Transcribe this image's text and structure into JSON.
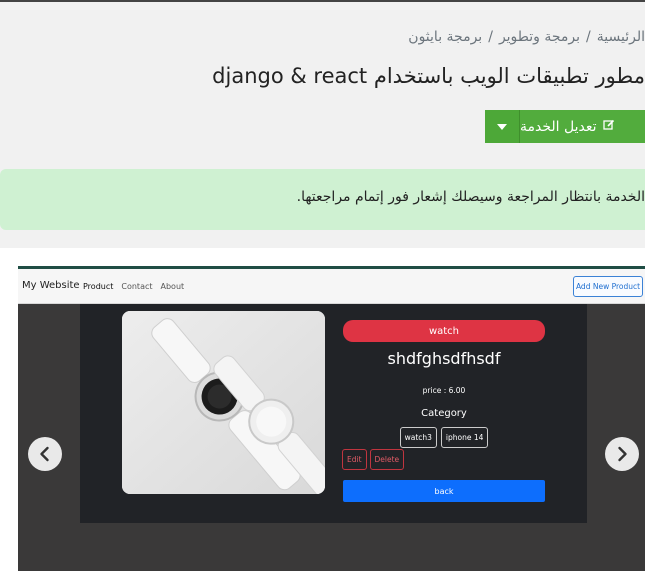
{
  "breadcrumb": {
    "items": [
      "الرئيسية",
      "برمجة وتطوير",
      "برمجة بايثون"
    ],
    "separator": "/"
  },
  "page_title": "مطور تطبيقات الويب باستخدام django & react",
  "edit_service_button": {
    "label": "تعديل الخدمة",
    "icon": "edit-icon",
    "dropdown_icon": "caret-down-icon"
  },
  "alert": {
    "text": "الخدمة بانتظار المراجعة وسيصلك إشعار فور إتمام مراجعتها."
  },
  "screenshot": {
    "navbar": {
      "brand": "My Website",
      "links": [
        "Product",
        "Contact",
        "About"
      ],
      "add_button": "Add New Product"
    },
    "product": {
      "category_badge": "watch",
      "name": "shdfghsdfhsdf",
      "price": "price : 6.00",
      "category_heading": "Category",
      "tags": [
        "watch3",
        "iphone 14"
      ],
      "edit_label": "Edit",
      "delete_label": "Delete",
      "back_label": "back"
    },
    "carousel": {
      "prev_icon": "chevron-left-icon",
      "next_icon": "chevron-right-icon"
    }
  },
  "colors": {
    "success_button": "#52ac3d",
    "alert_bg": "#cff1d2",
    "danger": "#de3444",
    "primary": "#0d6efd",
    "card_bg": "#212327"
  }
}
